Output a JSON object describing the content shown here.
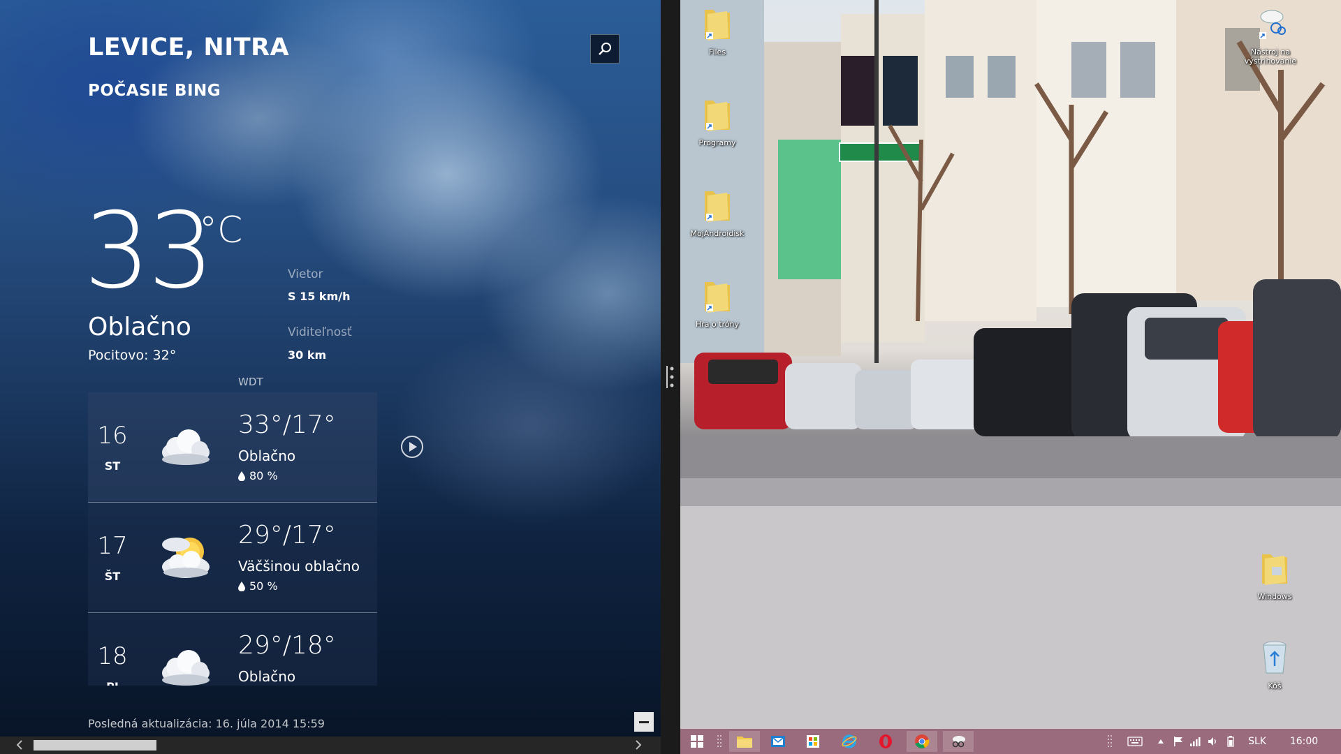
{
  "weather": {
    "city": "LEVICE, NITRA",
    "provider": "POČASIE BING",
    "temperature": "33",
    "unit": "°C",
    "condition": "Oblačno",
    "feels_like": "Pocitovo: 32°",
    "wind_label": "Vietor",
    "wind_value": "S 15 km/h",
    "visibility_label": "Viditeľnosť",
    "visibility_value": "30 km",
    "source": "WDT",
    "last_updated": "Posledná aktualizácia: 16. júla 2014 15:59",
    "forecast": [
      {
        "day": "16",
        "weekday": "ST",
        "temps": "33°/17°",
        "condition": "Oblačno",
        "rain": "80 %",
        "icon": "cloudy-icon"
      },
      {
        "day": "17",
        "weekday": "ŠT",
        "temps": "29°/17°",
        "condition": "Väčšinou oblačno",
        "rain": "50 %",
        "icon": "partly-cloudy-icon"
      },
      {
        "day": "18",
        "weekday": "PI",
        "temps": "29°/18°",
        "condition": "Oblačno",
        "rain": "",
        "icon": "cloudy-icon"
      }
    ]
  },
  "desktop": {
    "icons": [
      {
        "label": "Files",
        "kind": "folder-shortcut-icon"
      },
      {
        "label": "Programy",
        "kind": "folder-shortcut-icon"
      },
      {
        "label": "MojAndroidisk",
        "kind": "folder-shortcut-icon"
      },
      {
        "label": "Hra o tróny",
        "kind": "folder-shortcut-icon"
      },
      {
        "label": "Nástroj na výstrihovanie",
        "kind": "snipping-tool-icon"
      },
      {
        "label": "Windows",
        "kind": "folder-icon"
      },
      {
        "label": "Kôš",
        "kind": "recycle-bin-icon"
      }
    ]
  },
  "taskbar": {
    "language": "SLK",
    "time": "16:00"
  },
  "colors": {
    "taskbar": "#9a6b7c",
    "weather_sky": "#264e82",
    "folder": "#e8c24a"
  }
}
